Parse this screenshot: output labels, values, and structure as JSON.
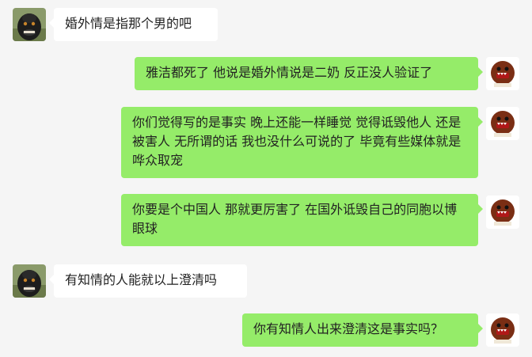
{
  "chat": {
    "messages": [
      {
        "from": "other",
        "avatar": "monkey-avatar",
        "text": "婚外情是指那个男的吧"
      },
      {
        "from": "self",
        "avatar": "domo-avatar",
        "text": "雅洁都死了 他说是婚外情说是二奶 反正没人验证了"
      },
      {
        "from": "self",
        "avatar": "domo-avatar",
        "text": "你们觉得写的是事实 晚上还能一样睡觉 觉得诋毁他人 还是被害人 无所谓的话 我也没什么可说的了 毕竟有些媒体就是哗众取宠"
      },
      {
        "from": "self",
        "avatar": "domo-avatar",
        "text": "你要是个中国人 那就更厉害了 在国外诋毁自己的同胞以博眼球"
      },
      {
        "from": "other",
        "avatar": "monkey-avatar",
        "text": "有知情的人能就以上澄清吗"
      },
      {
        "from": "self",
        "avatar": "domo-avatar",
        "text": "你有知情人出来澄清这是事实吗？"
      }
    ]
  },
  "colors": {
    "background": "#f5f5f5",
    "sent_bubble": "#95ec69",
    "received_bubble": "#ffffff"
  }
}
